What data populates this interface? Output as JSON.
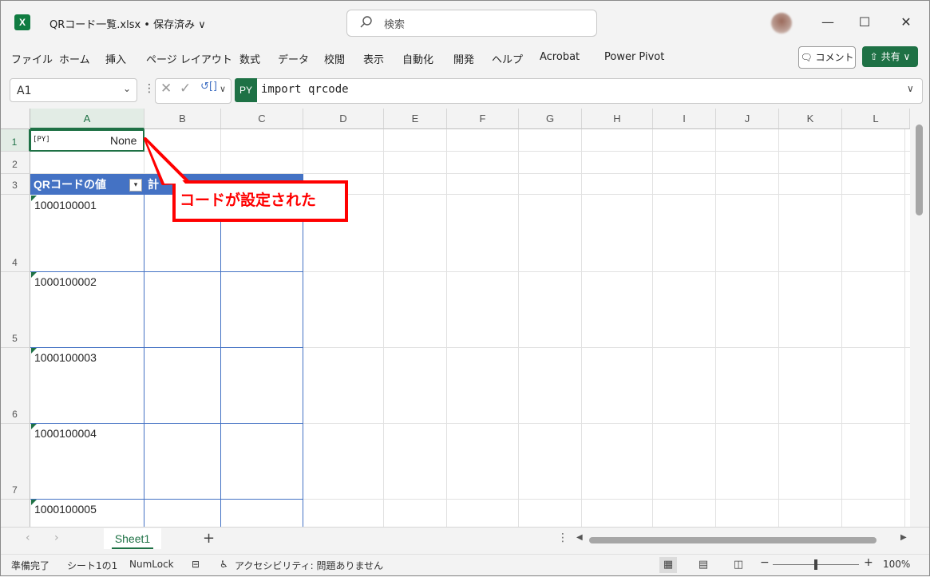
{
  "title_bar": {
    "app_logo": "X",
    "doc_title": "QRコード一覧.xlsx • 保存済み ∨",
    "search_placeholder": "検索",
    "minimize": "—",
    "maximize": "☐",
    "close": "✕"
  },
  "ribbon": {
    "menu": [
      "ファイル",
      "ホーム",
      "挿入",
      "ページ レイアウト",
      "数式",
      "データ",
      "校閲",
      "表示",
      "自動化",
      "開発",
      "ヘルプ",
      "Acrobat",
      "Power Pivot"
    ],
    "comment_label": "コメント",
    "share_label": "共有"
  },
  "formula_bar": {
    "name_box": "A1",
    "py_badge": "PY",
    "formula": "import qrcode"
  },
  "grid": {
    "columns": [
      "A",
      "B",
      "C",
      "D",
      "E",
      "F",
      "G",
      "H",
      "I",
      "J",
      "K",
      "L"
    ],
    "rows": [
      "1",
      "2",
      "3",
      "4",
      "5",
      "6",
      "7"
    ],
    "cell_a1_icon": "[PY]",
    "cell_a1_value": "None",
    "table_header": [
      "QRコードの値",
      "計"
    ],
    "table_values": [
      "1000100001",
      "1000100002",
      "1000100003",
      "1000100004",
      "1000100005"
    ]
  },
  "callout": {
    "text": "コードが設定された"
  },
  "sheets": {
    "tabs": [
      "Sheet1"
    ],
    "add_label": "+"
  },
  "status_bar": {
    "ready": "準備完了",
    "sheet_info": "シート1の1",
    "numlock": "NumLock",
    "accessibility": "アクセシビリティ: 問題ありません",
    "zoom": "100%"
  }
}
